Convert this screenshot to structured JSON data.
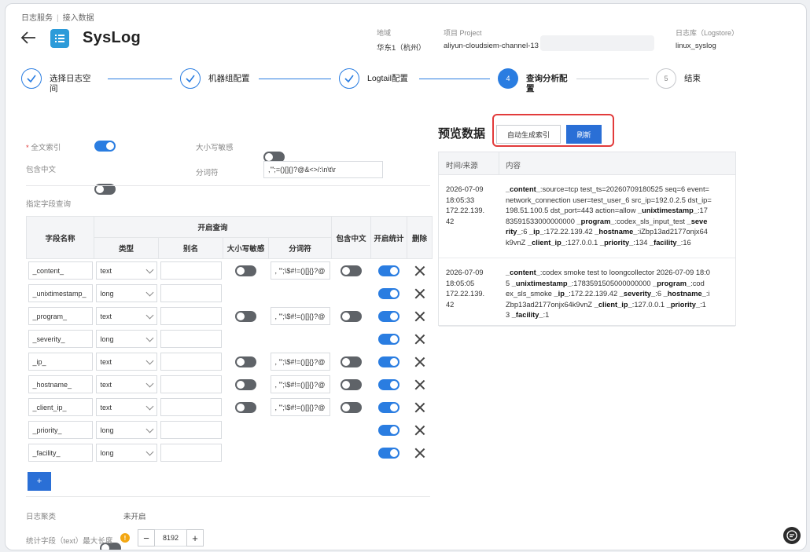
{
  "breadcrumb": [
    "日志服务",
    "接入数据"
  ],
  "app": {
    "title": "SysLog"
  },
  "meta": [
    {
      "label": "地域",
      "value": "华东1（杭州）"
    },
    {
      "label": "项目 Project",
      "value": "aliyun-cloudsiem-channel-13"
    },
    {
      "label": "日志库（Logstore）",
      "value": "linux_syslog"
    }
  ],
  "steps": [
    {
      "label_l1": "选择日志空",
      "label_l2": "间"
    },
    {
      "label_l1": "机器组配置",
      "label_l2": ""
    },
    {
      "label_l1": "Logtail配置",
      "label_l2": ""
    },
    {
      "num": "4",
      "label_l1": "查询分析配",
      "label_l2": "置"
    },
    {
      "num": "5",
      "label_l1": "结束",
      "label_l2": ""
    }
  ],
  "index": {
    "fulltext_label": "全文索引",
    "fulltext_prefix": "*",
    "case_label": "大小写敏感",
    "chinese_label": "包含中文",
    "tokenizer_label": "分词符",
    "tokenizer_value": ",'\";=()[]{}?@&<>/:\\n\\t\\r",
    "field_query_label": "指定字段查询"
  },
  "table": {
    "headers": {
      "field_name": "字段名称",
      "enable_query": "开启查询",
      "type": "类型",
      "alias": "别名",
      "case_sensitive": "大小写敏感",
      "tokenizer": "分词符",
      "include_chinese": "包含中文",
      "enable_stats": "开启统计",
      "delete": "删除"
    },
    "rows": [
      {
        "name": "_content_",
        "type": "text",
        "tok": ", '\";\\$#!=()[]{}?@",
        "case": false,
        "chinese": false,
        "stats": true
      },
      {
        "name": "_unixtimestamp_",
        "type": "long",
        "stats": true
      },
      {
        "name": "_program_",
        "type": "text",
        "tok": ", '\";\\$#!=()[]{}?@",
        "case": false,
        "chinese": false,
        "stats": true
      },
      {
        "name": "_severity_",
        "type": "long",
        "stats": true
      },
      {
        "name": "_ip_",
        "type": "text",
        "tok": ", '\";\\$#!=()[]{}?@",
        "case": false,
        "chinese": false,
        "stats": true
      },
      {
        "name": "_hostname_",
        "type": "text",
        "tok": ", '\";\\$#!=()[]{}?@",
        "case": false,
        "chinese": false,
        "stats": true
      },
      {
        "name": "_client_ip_",
        "type": "text",
        "tok": ", '\";\\$#!=()[]{}?@",
        "case": false,
        "chinese": false,
        "stats": true
      },
      {
        "name": "_priority_",
        "type": "long",
        "stats": true
      },
      {
        "name": "_facility_",
        "type": "long",
        "stats": true
      }
    ],
    "add_label": "+"
  },
  "footer": {
    "log_clustering_label": "日志聚类",
    "log_clustering_status": "未开启",
    "stat_field_label": "统计字段（text）最大长度",
    "stat_max_len": "8192",
    "minus": "−",
    "plus": "+"
  },
  "preview": {
    "title": "预览数据",
    "auto_index_label": "自动生成索引",
    "refresh_label": "刷新",
    "col_time": "时间/来源",
    "col_content": "内容",
    "rows": [
      {
        "date": "2026-07-09",
        "time": "18:05:33",
        "source": "172.22.139.",
        "source2": "42",
        "content": [
          [
            [
              "_content_",
              ":source=tcp test_ts=20260709180525 seq=6 event="
            ]
          ],
          [
            [
              "",
              "network_connection user=test_user_6 src_ip=192.0.2.5 dst_ip="
            ]
          ],
          [
            [
              "",
              "198.51.100.5 dst_port=443 action=allow "
            ],
            [
              "_unixtimestamp_",
              ":17"
            ]
          ],
          [
            [
              "",
              "83591533000000000 "
            ],
            [
              "_program_",
              ":codex_sls_input_test "
            ],
            [
              "_seve",
              ""
            ]
          ],
          [
            [
              "rity_",
              ":6 "
            ],
            [
              "_ip_",
              ":172.22.139.42 "
            ],
            [
              "_hostname_",
              ":iZbp13ad2177onjx64"
            ]
          ],
          [
            [
              "",
              "k9vnZ "
            ],
            [
              "_client_ip_",
              ":127.0.0.1 "
            ],
            [
              "_priority_",
              ":134 "
            ],
            [
              "_facility_",
              ":16"
            ]
          ]
        ]
      },
      {
        "date": "2026-07-09",
        "time": "18:05:05",
        "source": "172.22.139.",
        "source2": "42",
        "content": [
          [
            [
              "_content_",
              ":codex smoke test to loongcollector 2026-07-09 18:0"
            ]
          ],
          [
            [
              "",
              "5 "
            ],
            [
              "_unixtimestamp_",
              ":1783591505000000000 "
            ],
            [
              "_program_",
              ":cod"
            ]
          ],
          [
            [
              "",
              "ex_sls_smoke "
            ],
            [
              "_ip_",
              ":172.22.139.42 "
            ],
            [
              "_severity_",
              ":6 "
            ],
            [
              "_hostname_",
              ":i"
            ]
          ],
          [
            [
              "",
              "Zbp13ad2177onjx64k9vnZ "
            ],
            [
              "_client_ip_",
              ":127.0.0.1 "
            ],
            [
              "_priority_",
              ":1"
            ]
          ],
          [
            [
              "",
              "3 "
            ],
            [
              "_facility_",
              ":1"
            ]
          ]
        ]
      }
    ]
  },
  "colors": {
    "primary": "#2a7de1",
    "highlight": "#e23b3b",
    "logo": "#2c9bd9"
  }
}
